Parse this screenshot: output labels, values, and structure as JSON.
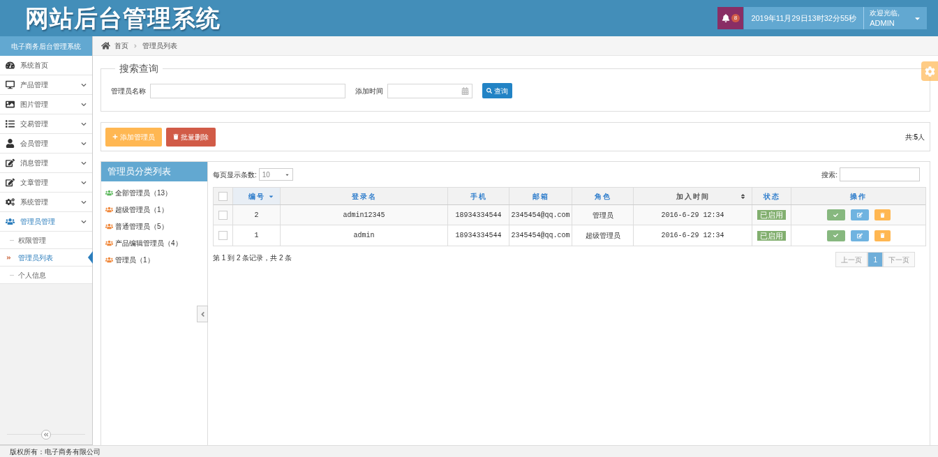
{
  "header": {
    "title": "网站后台管理系统",
    "notifications": "8",
    "datetime": "2019年11月29日13时32分55秒",
    "welcome": "欢迎光临,",
    "user": "ADMIN"
  },
  "sidebar": {
    "title": "电子商务后台管理系统",
    "items": [
      {
        "label": "系统首页",
        "kind": "home",
        "selected": false
      },
      {
        "label": "产品管理",
        "kind": "desktop",
        "selected": false
      },
      {
        "label": "图片管理",
        "kind": "image",
        "selected": false
      },
      {
        "label": "交易管理",
        "kind": "list",
        "selected": false
      },
      {
        "label": "会员管理",
        "kind": "user",
        "selected": false
      },
      {
        "label": "消息管理",
        "kind": "edit",
        "selected": false
      },
      {
        "label": "文章管理",
        "kind": "edit",
        "selected": false
      },
      {
        "label": "系统管理",
        "kind": "cogs",
        "selected": false
      },
      {
        "label": "管理员管理",
        "kind": "users",
        "selected": true,
        "children": [
          {
            "label": "权限管理",
            "selected": false
          },
          {
            "label": "管理员列表",
            "selected": true
          },
          {
            "label": "个人信息",
            "selected": false
          }
        ]
      }
    ]
  },
  "breadcrumb": [
    "首页",
    "管理员列表"
  ],
  "search_panel": {
    "legend": "搜索查询",
    "fields": [
      {
        "label": "管理员名称",
        "kind": "text"
      },
      {
        "label": "添加时间",
        "kind": "date"
      }
    ],
    "button": "查询"
  },
  "toolbar": {
    "buttons": [
      {
        "label": "添加管理员",
        "kind": "add"
      },
      {
        "label": "批量删除",
        "kind": "delete"
      }
    ],
    "total_label": "共:",
    "total": "5",
    "total_unit": "人"
  },
  "categories": {
    "title": "管理员分类列表",
    "items": [
      {
        "label": "全部管理员（13）",
        "color": "#5cb85c"
      },
      {
        "label": "超级管理员（1）",
        "color": "#f0883b"
      },
      {
        "label": "普通管理员（5）",
        "color": "#f0883b"
      },
      {
        "label": "产品编辑管理员（4）",
        "color": "#f0883b"
      },
      {
        "label": "管理员（1）",
        "color": "#f0883b"
      }
    ]
  },
  "table": {
    "page_size_label": "每页显示条数:",
    "page_size": "10",
    "search_label": "搜索:",
    "select_all": {
      "checked": false
    },
    "columns": [
      {
        "label": "编号",
        "sorted": true,
        "sortable": true
      },
      {
        "label": "登录名",
        "sorted": false,
        "sortable": false
      },
      {
        "label": "手机",
        "sorted": false,
        "sortable": false
      },
      {
        "label": "邮箱",
        "sorted": false,
        "sortable": false
      },
      {
        "label": "角色",
        "sorted": false,
        "sortable": false
      },
      {
        "label": "加入时间",
        "sorted": false,
        "sortable": true
      },
      {
        "label": "状态",
        "sorted": false,
        "sortable": false
      },
      {
        "label": "操作",
        "sorted": false,
        "sortable": false
      }
    ],
    "rows": [
      {
        "checked": false,
        "id": "2",
        "login": "admin12345",
        "phone": "18934334544",
        "email": "2345454@qq.com",
        "role": "管理员",
        "joined": "2016-6-29 12:34",
        "status": "已启用"
      },
      {
        "checked": false,
        "id": "1",
        "login": "admin",
        "phone": "18934334544",
        "email": "2345454@qq.com",
        "role": "超级管理员",
        "joined": "2016-6-29 12:34",
        "status": "已启用"
      }
    ],
    "info": "第 1 到 2 条记录，共 2 条",
    "pagination": [
      {
        "label": "上一页",
        "selected": false
      },
      {
        "label": "1",
        "selected": true
      },
      {
        "label": "下一页",
        "selected": false
      }
    ]
  },
  "footer": "版权所有：电子商务有限公司"
}
